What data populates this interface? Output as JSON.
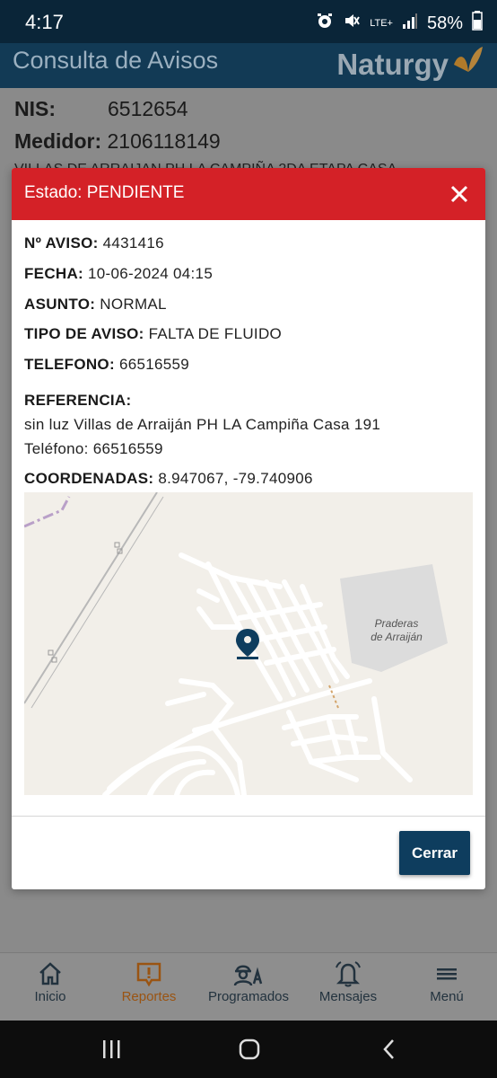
{
  "status_bar": {
    "time": "4:17",
    "network": "LTE+",
    "battery": "58%"
  },
  "header": {
    "title": "Consulta de Avisos",
    "brand": "Naturgy"
  },
  "background": {
    "nis_label": "NIS:",
    "nis_value": "6512654",
    "medidor_label": "Medidor:",
    "medidor_value": "2106118149",
    "address": "VILLAS DE ARRAIJAN PH LA CAMPIÑA 2DA ETAPA CASA"
  },
  "modal": {
    "title": "Estado: PENDIENTE",
    "fields": [
      {
        "label": "Nº AVISO:",
        "value": "4431416"
      },
      {
        "label": "FECHA:",
        "value": "10-06-2024 04:15"
      },
      {
        "label": "ASUNTO:",
        "value": "NORMAL"
      },
      {
        "label": "TIPO DE AVISO:",
        "value": "FALTA DE FLUIDO"
      },
      {
        "label": "TELEFONO:",
        "value": "66516559"
      }
    ],
    "referencia_label": "REFERENCIA:",
    "referencia_lines": [
      "sin luz Villas de Arraiján PH LA Campiña Casa 191",
      "Teléfono: 66516559"
    ],
    "coordenadas_label": "COORDENADAS:",
    "coordenadas_value": "8.947067, -79.740906",
    "map_label_line1": "Praderas",
    "map_label_line2": "de Arraiján",
    "close_button": "Cerrar"
  },
  "bottom_nav": {
    "items": [
      {
        "label": "Inicio",
        "icon": "home-icon"
      },
      {
        "label": "Reportes",
        "icon": "report-icon",
        "active": true
      },
      {
        "label": "Programados",
        "icon": "worker-icon"
      },
      {
        "label": "Mensajes",
        "icon": "bell-icon"
      },
      {
        "label": "Menú",
        "icon": "hamburger-icon"
      }
    ]
  },
  "colors": {
    "header_bg": "#123a55",
    "modal_header": "#d42127",
    "button": "#0e3d5e",
    "active_nav": "#9a5412",
    "map_pin": "#0e3d5e"
  }
}
